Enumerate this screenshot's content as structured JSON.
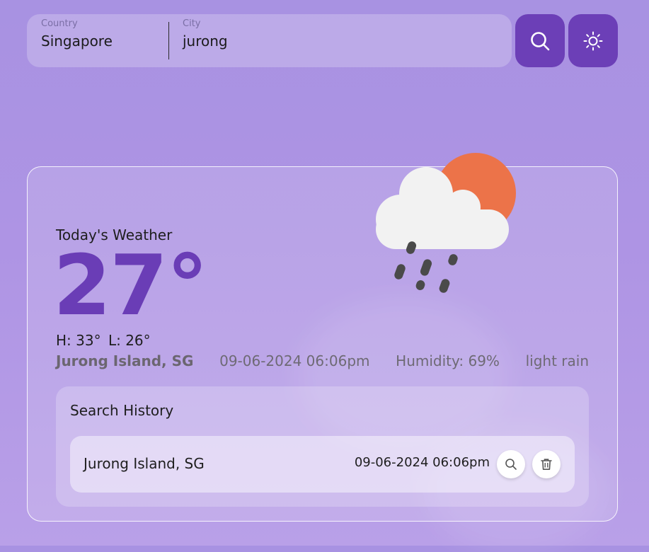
{
  "search": {
    "country_label": "Country",
    "country_value": "Singapore",
    "city_label": "City",
    "city_value": "jurong"
  },
  "toolbar": {
    "search_icon": "search-icon",
    "theme_icon": "sun-icon"
  },
  "weather": {
    "heading": "Today's Weather",
    "temperature": "27°",
    "high": "H: 33°",
    "low": "L: 26°",
    "location": "Jurong Island, SG",
    "datetime": "09-06-2024 06:06pm",
    "humidity": "Humidity: 69%",
    "description": "light rain",
    "icon": "cloud-sun-rain-icon"
  },
  "history": {
    "title": "Search History",
    "items": [
      {
        "location": "Jurong Island, SG",
        "datetime": "09-06-2024 06:06pm"
      }
    ]
  },
  "colors": {
    "accent": "#6a3db6",
    "button": "#6c3fb7",
    "sun": "#ec7349"
  }
}
